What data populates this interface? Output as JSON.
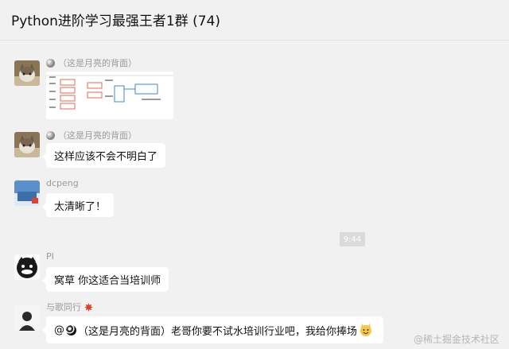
{
  "header": {
    "title": "Python进阶学习最强王者1群 (74)"
  },
  "messages": [
    {
      "sender": "（这是月亮的背面）",
      "type": "image"
    },
    {
      "sender": "（这是月亮的背面）",
      "text": "这样应该不会不明白了"
    },
    {
      "sender": "dcpeng",
      "text": "太清晰了！"
    },
    {
      "time": "9:44"
    },
    {
      "sender": "PI",
      "text": "窝草  你这适合当培训师"
    },
    {
      "sender": "与歌同行",
      "mention": "@",
      "mention_name": "（这是月亮的背面）",
      "text": " 老哥你要不试水培训行业吧，我给你捧场"
    }
  ],
  "watermark": "@稀土掘金技术社区",
  "colors": {
    "background": "#f1f1f1",
    "bubble": "#ffffff",
    "sender_text": "#9a9a9a"
  }
}
